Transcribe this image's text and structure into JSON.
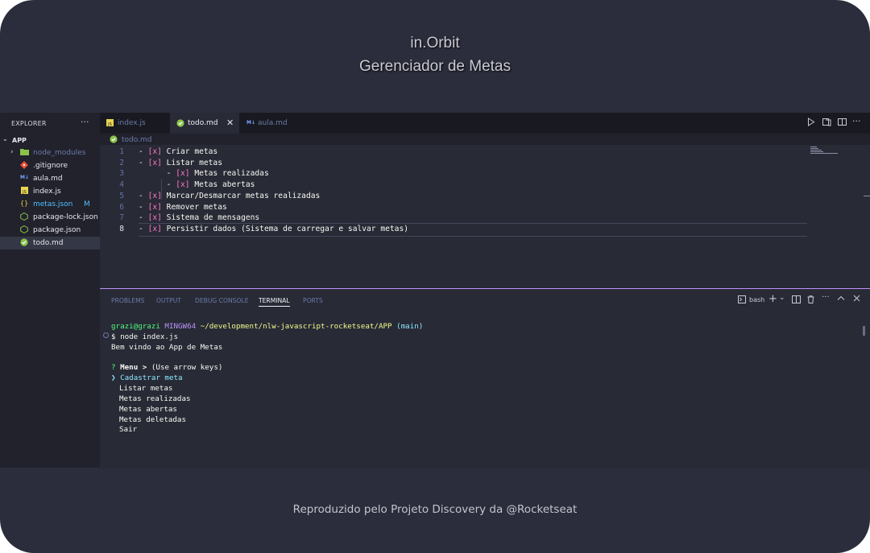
{
  "header": {
    "title": "in.Orbit",
    "subtitle": "Gerenciador de Metas"
  },
  "footer": {
    "text": "Reproduzido pelo Projeto Discovery da @Rocketseat"
  },
  "explorer": {
    "heading": "EXPLORER",
    "more": "···",
    "folder": "APP",
    "files": [
      {
        "name": "node_modules",
        "icon": "folder-icon",
        "color": "#6b7aa8"
      },
      {
        "name": ".gitignore",
        "icon": "git-icon"
      },
      {
        "name": "aula.md",
        "icon": "markdown-icon"
      },
      {
        "name": "index.js",
        "icon": "javascript-icon"
      },
      {
        "name": "metas.json",
        "icon": "json-icon",
        "badge": "M",
        "color": "#4fc1ff"
      },
      {
        "name": "package-lock.json",
        "icon": "npm-icon"
      },
      {
        "name": "package.json",
        "icon": "npm-icon"
      },
      {
        "name": "todo.md",
        "icon": "check-circle-icon",
        "selected": true
      }
    ]
  },
  "tabs": [
    {
      "label": "index.js",
      "icon": "javascript-icon",
      "active": false
    },
    {
      "label": "todo.md",
      "icon": "check-circle-icon",
      "active": true,
      "close": "✕"
    },
    {
      "label": "aula.md",
      "icon": "markdown-icon",
      "active": false
    }
  ],
  "breadcrumb": {
    "file": "todo.md"
  },
  "editor": {
    "lines": [
      {
        "num": "1",
        "indent": "",
        "text": "Criar metas"
      },
      {
        "num": "2",
        "indent": "",
        "text": "Listar metas"
      },
      {
        "num": "3",
        "indent": "    ",
        "text": "Metas realizadas"
      },
      {
        "num": "4",
        "indent": "    ",
        "text": "Metas abertas"
      },
      {
        "num": "5",
        "indent": "",
        "text": "Marcar/Desmarcar metas realizadas"
      },
      {
        "num": "6",
        "indent": "",
        "text": "Remover metas"
      },
      {
        "num": "7",
        "indent": "",
        "text": "Sistema de mensagens"
      },
      {
        "num": "8",
        "indent": "",
        "text": "Persistir dados (Sistema de carregar e salvar metas)"
      }
    ],
    "bullet": "- ",
    "checkbox": "[x]",
    "current_line": "8"
  },
  "panel": {
    "tabs": [
      "PROBLEMS",
      "OUTPUT",
      "DEBUG CONSOLE",
      "TERMINAL",
      "PORTS"
    ],
    "active_tab": "TERMINAL",
    "shell": "bash"
  },
  "terminal": {
    "user": "grazi@grazi",
    "env": "MINGW64",
    "path": "~/development/nlw-javascript-rocketseat/APP",
    "branch": "(main)",
    "command": "$ node index.js",
    "welcome": "Bem vindo ao App de Metas",
    "prompt_mark": "?",
    "prompt_label": "Menu",
    "prompt_arrow": ">",
    "prompt_hint": "(Use arrow keys)",
    "pointer": "❯",
    "selected_option": "Cadastrar meta",
    "options": [
      "Listar metas",
      "Metas realizadas",
      "Metas abertas",
      "Metas deletadas",
      "Sair"
    ]
  },
  "colors": {
    "frame": "#2b2d3c",
    "editor_bg": "#282a36",
    "sidebar_bg": "#21222c",
    "accent": "#bd93f9",
    "checkbox": "#ff79c6",
    "prompt_green": "#50fa7b",
    "highlight_cyan": "#8be9fd"
  }
}
